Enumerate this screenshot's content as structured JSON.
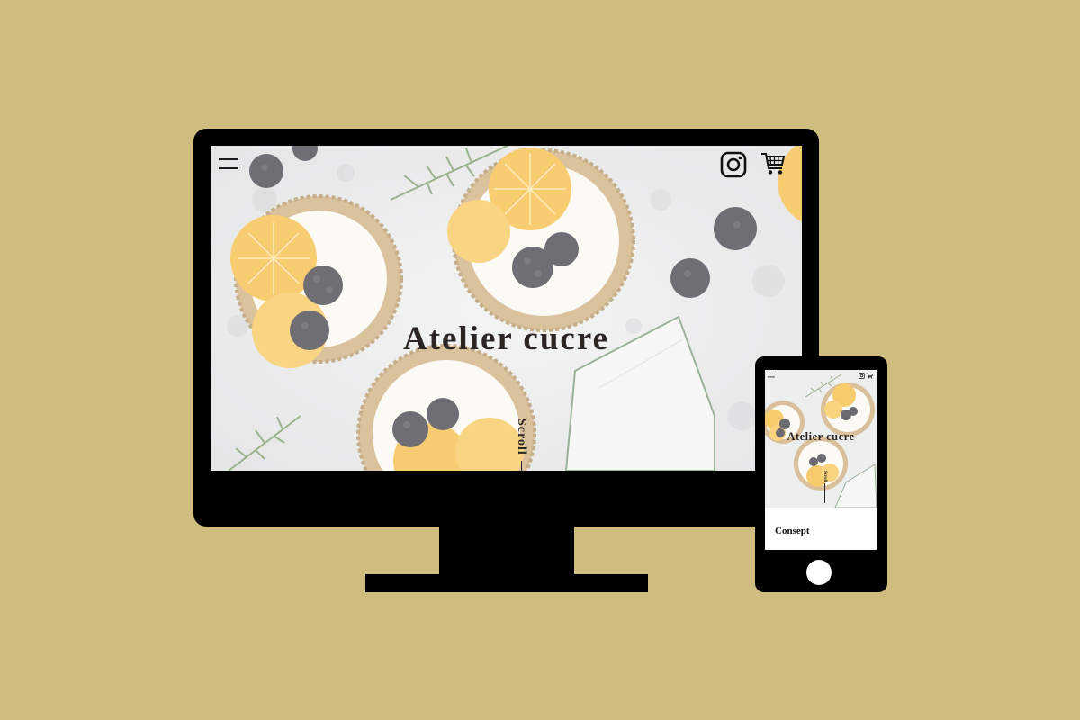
{
  "site": {
    "title": "Atelier cucre",
    "scroll_label": "Scroll",
    "section_label": "Consept"
  },
  "icons": {
    "menu": "hamburger-menu-icon",
    "instagram": "instagram-icon",
    "cart": "shopping-cart-icon",
    "home": "home-button"
  },
  "colors": {
    "background": "#cfbd80",
    "device": "#000000",
    "text": "#2b2623",
    "orange": "#f5b52e",
    "berry": "#2c2a33"
  }
}
